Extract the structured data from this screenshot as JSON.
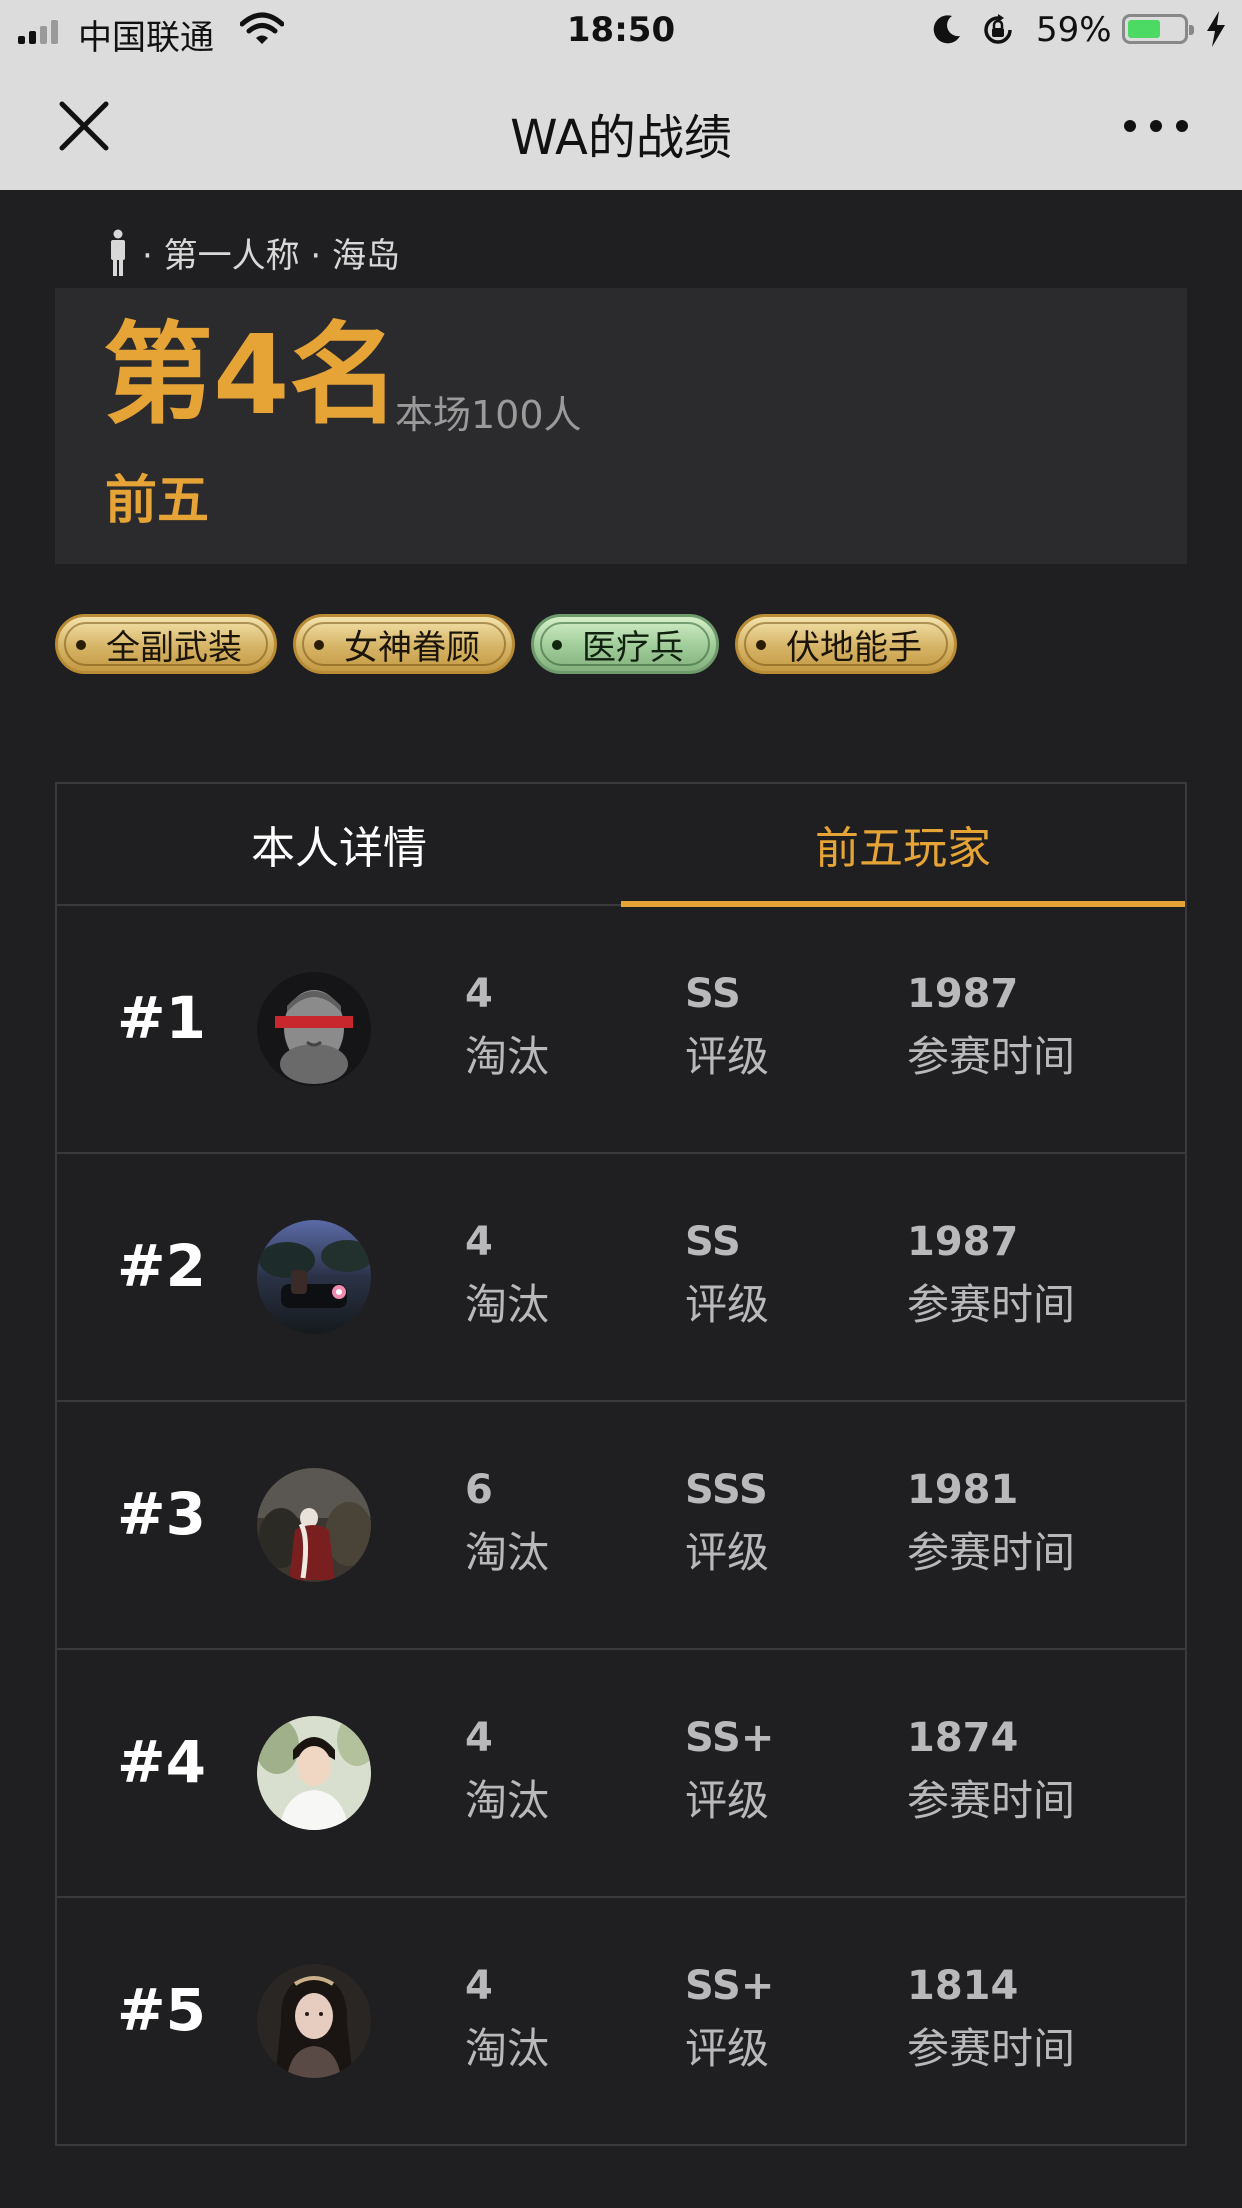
{
  "status_bar": {
    "carrier": "中国联通",
    "time": "18:50",
    "battery_percent": "59%",
    "battery_level": 0.59
  },
  "nav": {
    "title": "WA的战绩"
  },
  "match": {
    "mode": "· 第一人称 · 海岛",
    "rank": "第4名",
    "players": "本场100人",
    "tier": "前五"
  },
  "badges": [
    {
      "label": "全副武装",
      "color": "gold"
    },
    {
      "label": "女神眷顾",
      "color": "gold"
    },
    {
      "label": "医疗兵",
      "color": "green"
    },
    {
      "label": "伏地能手",
      "color": "gold"
    }
  ],
  "tabs": [
    {
      "label": "本人详情",
      "active": false
    },
    {
      "label": "前五玩家",
      "active": true
    }
  ],
  "players": [
    {
      "rank": "#1",
      "kills": "4",
      "kills_label": "淘汰",
      "grade": "SS",
      "grade_label": "评级",
      "time": "1987",
      "time_label": "参赛时间",
      "avatar": "statue-avatar"
    },
    {
      "rank": "#2",
      "kills": "4",
      "kills_label": "淘汰",
      "grade": "SS",
      "grade_label": "评级",
      "time": "1987",
      "time_label": "参赛时间",
      "avatar": "night-car-avatar"
    },
    {
      "rank": "#3",
      "kills": "6",
      "kills_label": "淘汰",
      "grade": "SSS",
      "grade_label": "评级",
      "time": "1981",
      "time_label": "参赛时间",
      "avatar": "game-character-avatar"
    },
    {
      "rank": "#4",
      "kills": "4",
      "kills_label": "淘汰",
      "grade": "SS+",
      "grade_label": "评级",
      "time": "1874",
      "time_label": "参赛时间",
      "avatar": "person-white-shirt-avatar"
    },
    {
      "rank": "#5",
      "kills": "4",
      "kills_label": "淘汰",
      "grade": "SS+",
      "grade_label": "评级",
      "time": "1814",
      "time_label": "参赛时间",
      "avatar": "woman-portrait-avatar"
    }
  ],
  "colors": {
    "accent": "#e6a336",
    "background": "#1f1f21",
    "card": "#2b2b2d",
    "header": "#dcdcdc"
  }
}
